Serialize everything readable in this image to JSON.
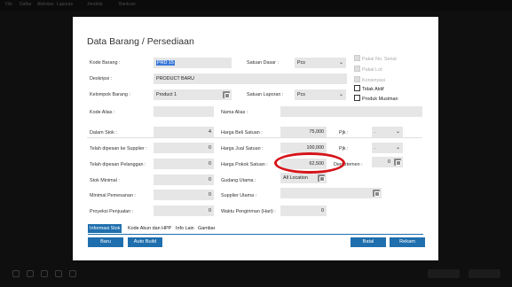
{
  "topbar": {
    "items": [
      "File",
      "Daftar",
      "Aktivitas",
      "Laporan",
      "Jendela",
      "Bantuan"
    ]
  },
  "dialog": {
    "title": "Data Barang / Persediaan",
    "kode_barang": {
      "label": "Kode Barang :",
      "value": "PRD 15"
    },
    "satuan_dasar": {
      "label": "Satuan Dasar :",
      "value": "Pcs"
    },
    "deskripsi": {
      "label": "Deskripsi :",
      "value": "PRODUCT BARU"
    },
    "kelompok_barang": {
      "label": "Kelompok Barang :",
      "value": "Product 1"
    },
    "satuan_laporan": {
      "label": "Satuan Laporan :",
      "value": "Pcs"
    },
    "kode_alias": {
      "label": "Kode Alias :",
      "value": ""
    },
    "nama_alias": {
      "label": "Nama Alias :",
      "value": ""
    },
    "checkboxes": {
      "pakai_no_serial": "Pakai No. Serial",
      "pakai_lot": "Pakai Lot",
      "konsinyasi": "Konsinyasi",
      "tidak_aktif": "Tidak Aktif",
      "produk_musiman": "Produk Musiman"
    },
    "dalam_stok": {
      "label": "Dalam Stok :",
      "value": "4"
    },
    "harga_beli": {
      "label": "Harga Beli Satuan :",
      "value": "75,000"
    },
    "pjk1": {
      "label": "Pjk :",
      "value": "."
    },
    "dipesan_supplier": {
      "label": "Telah dipesan ke Supplier :",
      "value": "0"
    },
    "harga_jual": {
      "label": "Harga Jual Satuan :",
      "value": "100,000"
    },
    "pjk2": {
      "label": "Pjk :",
      "value": "."
    },
    "dipesan_pelanggan": {
      "label": "Telah dipesan Pelanggan :",
      "value": "0"
    },
    "harga_pokok": {
      "label": "Harga Pokok Satuan :",
      "value": "62,500"
    },
    "departemen": {
      "label": "Departemen :",
      "value": "0"
    },
    "stok_minimal": {
      "label": "Stok Minimal :",
      "value": "0"
    },
    "gudang_utama": {
      "label": "Gudang Utama :",
      "value": "All Location"
    },
    "minimal_pemesanan": {
      "label": "Minimal Pemesanan :",
      "value": "0"
    },
    "supplier_utama": {
      "label": "Supplier Utama :",
      "value": ""
    },
    "proyeksi_penjualan": {
      "label": "Proyeksi Penjualan :",
      "value": "0"
    },
    "waktu_pengiriman": {
      "label": "Waktu Pengiriman (Hari) :",
      "value": "0"
    },
    "tabs": [
      "Informasi Stok",
      "Kode Akun dan HPP",
      "Info Lain",
      "Gambar"
    ],
    "buttons": {
      "baru": "Baru",
      "auto_build": "Auto Build",
      "batal": "Batal",
      "rekam": "Rekam"
    }
  },
  "colors": {
    "accent": "#1f6fae",
    "highlight_oval": "#d6131a",
    "selection": "#3a78d8"
  }
}
